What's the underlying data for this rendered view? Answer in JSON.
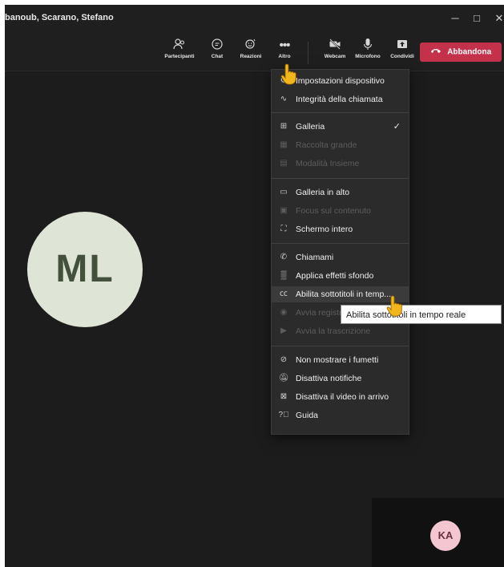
{
  "window": {
    "title": "banoub, Scarano, Stefano",
    "minimize_glyph": "─",
    "maximize_glyph": "□",
    "close_glyph": "✕"
  },
  "toolbar": {
    "participants": {
      "label": "Partecipanti",
      "icon": "people-icon"
    },
    "chat": {
      "label": "Chat",
      "icon": "chat-icon"
    },
    "reactions": {
      "label": "Reazioni",
      "icon": "reaction-icon"
    },
    "more": {
      "label": "Altro",
      "icon": "more-icon"
    },
    "webcam": {
      "label": "Webcam",
      "icon": "camera-off-icon"
    },
    "microphone": {
      "label": "Microfono",
      "icon": "mic-icon"
    },
    "share": {
      "label": "Condividi",
      "icon": "share-icon"
    },
    "leave": {
      "label": "Abbandona",
      "icon": "phone-hangup-icon"
    }
  },
  "menu": {
    "items": [
      {
        "label": "Impostazioni dispositivo",
        "icon": "settings-icon",
        "enabled": true
      },
      {
        "label": "Integrità della chiamata",
        "icon": "pulse-icon",
        "enabled": true
      },
      {
        "label": "Galleria",
        "icon": "grid-icon",
        "enabled": true,
        "checked": true
      },
      {
        "label": "Raccolta grande",
        "icon": "large-grid-icon",
        "enabled": false
      },
      {
        "label": "Modalità Insieme",
        "icon": "together-icon",
        "enabled": false
      },
      {
        "label": "Galleria in alto",
        "icon": "gallery-top-icon",
        "enabled": true
      },
      {
        "label": "Focus sul contenuto",
        "icon": "focus-icon",
        "enabled": false
      },
      {
        "label": "Schermo intero",
        "icon": "fullscreen-icon",
        "enabled": true
      },
      {
        "label": "Chiamami",
        "icon": "phone-icon",
        "enabled": true
      },
      {
        "label": "Applica effetti sfondo",
        "icon": "background-icon",
        "enabled": true
      },
      {
        "label": "Abilita sottotitoli in temp...",
        "icon": "captions-icon",
        "enabled": true,
        "hovered": true
      },
      {
        "label": "Avvia registrazione",
        "icon": "record-icon",
        "enabled": false
      },
      {
        "label": "Avvia la trascrizione",
        "icon": "transcript-icon",
        "enabled": false
      },
      {
        "label": "Non mostrare i fumetti",
        "icon": "no-bubbles-icon",
        "enabled": true
      },
      {
        "label": "Disattiva notifiche",
        "icon": "notifications-off-icon",
        "enabled": true
      },
      {
        "label": "Disattiva il video in arrivo",
        "icon": "video-off-icon",
        "enabled": true
      },
      {
        "label": "Guida",
        "icon": "help-icon",
        "enabled": true
      }
    ]
  },
  "tooltip": {
    "text": "Abilita sottotitoli in tempo reale"
  },
  "participants": {
    "main_initials": "ML",
    "self_initials": "KA"
  },
  "colors": {
    "leave": "#c4314b",
    "menu_bg": "#2b2b2b",
    "stage_bg": "#1c1c1c",
    "avatar_main": "#dfe5d6",
    "avatar_self": "#f4c6d1"
  }
}
